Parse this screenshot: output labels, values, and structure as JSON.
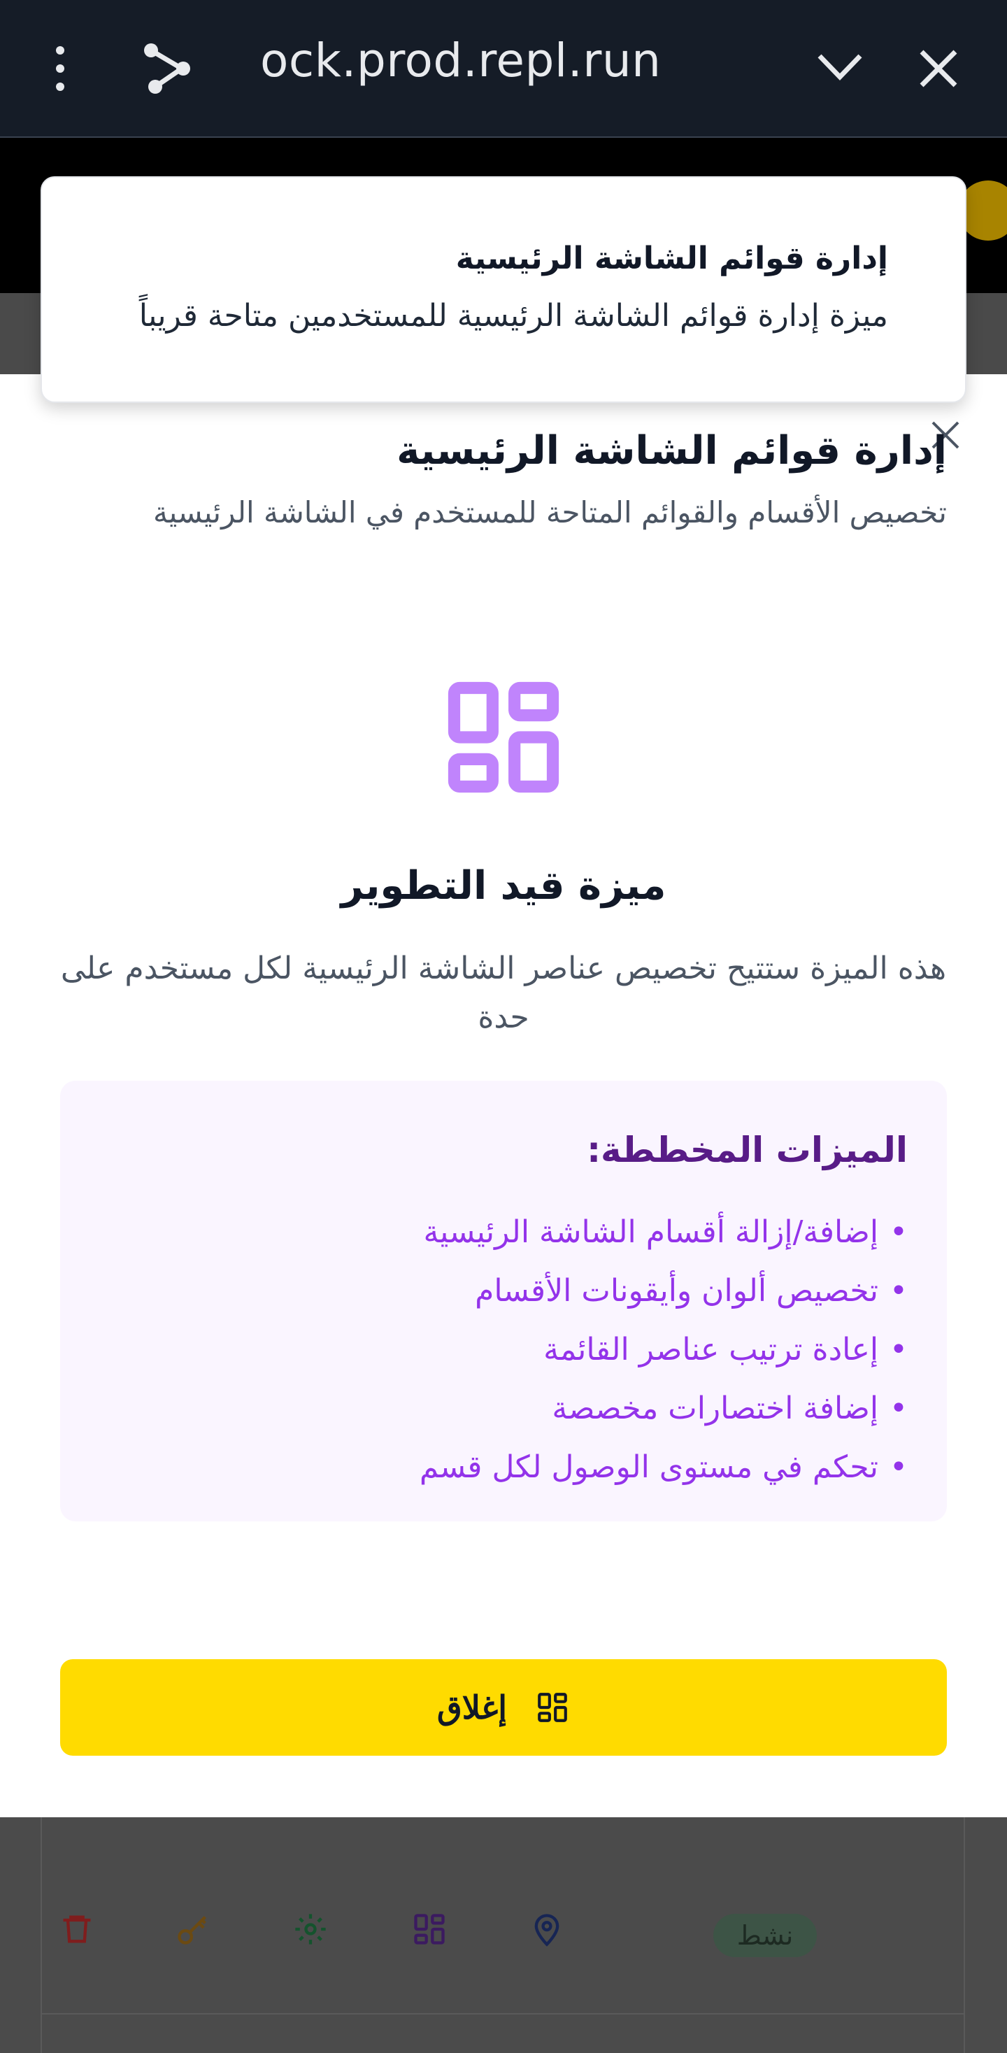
{
  "browser": {
    "url": "ock.prod.repl.run",
    "icons": [
      "more-vert-icon",
      "share-icon",
      "chevron-down-icon",
      "close-icon"
    ]
  },
  "toast": {
    "title": "إدارة قوائم الشاشة الرئيسية",
    "message": "ميزة إدارة قوائم الشاشة الرئيسية للمستخدمين متاحة قريباً"
  },
  "modal": {
    "title": "إدارة قوائم الشاشة الرئيسية",
    "subtitle": "تخصيص الأقسام والقوائم المتاحة للمستخدم في الشاشة الرئيسية",
    "dev_title": "ميزة قيد التطوير",
    "dev_description": "هذه الميزة ستتيح تخصيص عناصر الشاشة الرئيسية لكل مستخدم على حدة",
    "planned_title": "الميزات المخططة:",
    "planned_items": [
      "إضافة/إزالة أقسام الشاشة الرئيسية",
      "تخصيص ألوان وأيقونات الأقسام",
      "إعادة ترتيب عناصر القائمة",
      "إضافة اختصارات مخصصة",
      "تحكم في مستوى الوصول لكل قسم"
    ],
    "close_label": "إغلاق"
  },
  "background_row": {
    "status": "نشط",
    "icons": [
      "trash-icon",
      "key-icon",
      "settings-icon",
      "layout-grid-icon",
      "map-pin-icon"
    ]
  },
  "colors": {
    "accent_yellow": "#ffdb00",
    "purple": "#9333ea",
    "purple_dark": "#581c87",
    "icon_purple": "#c084fc",
    "chrome_bg": "#151c27"
  }
}
